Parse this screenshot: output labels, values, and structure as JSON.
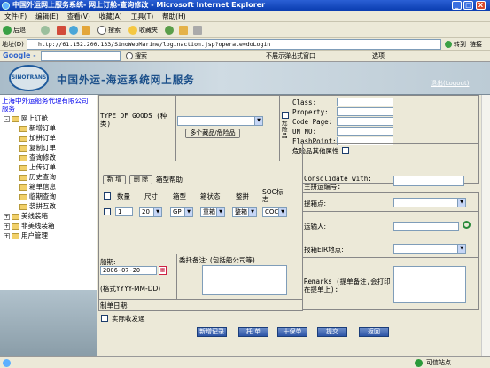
{
  "window": {
    "title": "中国外运网上服务系统- 网上订舱-查询修改 - Microsoft Internet Explorer",
    "min": "_",
    "max": "□",
    "close": "X"
  },
  "menu": [
    "文件(F)",
    "编辑(E)",
    "查看(V)",
    "收藏(A)",
    "工具(T)",
    "帮助(H)"
  ],
  "toolbar": {
    "back": "后退",
    "search": "搜索",
    "favorites": "收藏夹"
  },
  "address": {
    "label": "地址(D)",
    "url": "http://61.152.200.133/SinoWebMarine/loginaction.jsp?operate=doLogin",
    "go": "转到",
    "links": "链接"
  },
  "google": {
    "label": "Google -",
    "search_btn": "搜索",
    "blocked": "不展示弹出式窗口",
    "options": "选项"
  },
  "banner": {
    "logo": "SINOTRANS",
    "title": "中国外运-海运系统网上服务",
    "exit": "退出(Logout)"
  },
  "sidebar": {
    "company": "上海中外运船务代理有限公司服务",
    "root": "网上订舱",
    "items": [
      "新增订单",
      "加拼订单",
      "复制订单",
      "查询修改",
      "上传订单",
      "历史查询",
      "箱单信息",
      "临期查询",
      "装拼互改"
    ],
    "groups": [
      "美线装箱",
      "非美线装箱",
      "用户管理"
    ]
  },
  "goods": {
    "type_label": "TYPE OF GOODS (种类)",
    "multi_btn": "多个藏品/危险品",
    "dangerous_label": "危险品",
    "class": "Class:",
    "property": "Property:",
    "code_page": "Code Page:",
    "un_no": "UN NO:",
    "flashpoint": "FlashPoint:",
    "other_attr": "危险品其他属性"
  },
  "container": {
    "add_btn": "新 增",
    "delete_btn": "删 除",
    "help": "箱型帮助",
    "headers": [
      "数量",
      "尺寸",
      "箱型",
      "箱状态",
      "整拼",
      "SOC标志"
    ],
    "row": {
      "qty": "1",
      "size": "20",
      "type": "GP",
      "status": "重箱",
      "fill": "整箱",
      "soc": "COC"
    }
  },
  "consolidate": {
    "label": "Consolidate with: 主拼运编号:"
  },
  "extract": {
    "label": "提箱点:"
  },
  "shipper": {
    "label": "运输人:"
  },
  "eir": {
    "label": "报箱EIR地点:"
  },
  "remarks": {
    "label": "Remarks (提单备注,会打印在提单上):"
  },
  "sailing": {
    "label": "船期:",
    "date": "2006-07-20",
    "format": "(格式YYYY-MM-DD)"
  },
  "notes": {
    "label": "委托备注: (包括船公司等)"
  },
  "made_date": {
    "label": "制单日期:"
  },
  "actual_ship": {
    "label": "实际收发通"
  },
  "actions": [
    "新增记录",
    "托 单",
    "十保单",
    "提交",
    "返回"
  ],
  "status": {
    "zone": "可信站点"
  }
}
